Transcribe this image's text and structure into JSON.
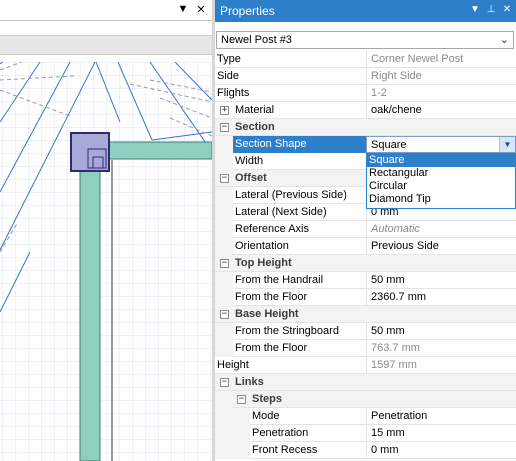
{
  "left_panel": {
    "chevron_icon": "chevron-down-icon",
    "close_icon": "close-icon"
  },
  "properties": {
    "title": "Properties",
    "object": "Newel Post #3",
    "rows": {
      "type": {
        "label": "Type",
        "value": "Corner Newel Post"
      },
      "side": {
        "label": "Side",
        "value": "Right Side"
      },
      "flights": {
        "label": "Flights",
        "value": "1-2"
      },
      "material": {
        "label": "Material",
        "value": "oak/chene"
      },
      "section": {
        "label": "Section"
      },
      "section_shape": {
        "label": "Section Shape",
        "value": "Square"
      },
      "width": {
        "label": "Width"
      },
      "offset": {
        "label": "Offset"
      },
      "lateral_prev": {
        "label": "Lateral (Previous Side)"
      },
      "lateral_next": {
        "label": "Lateral (Next Side)",
        "value": "0 mm"
      },
      "reference_axis": {
        "label": "Reference Axis",
        "value": "Automatic"
      },
      "orientation": {
        "label": "Orientation",
        "value": "Previous Side"
      },
      "top_height": {
        "label": "Top Height"
      },
      "top_from_handrail": {
        "label": "From the Handrail",
        "value": "50 mm"
      },
      "top_from_floor": {
        "label": "From the Floor",
        "value": "2360.7 mm"
      },
      "base_height": {
        "label": "Base Height"
      },
      "base_from_stringboard": {
        "label": "From the Stringboard",
        "value": "50 mm"
      },
      "base_from_floor": {
        "label": "From the Floor",
        "value": "763.7 mm"
      },
      "height": {
        "label": "Height",
        "value": "1597 mm"
      },
      "links": {
        "label": "Links"
      },
      "steps": {
        "label": "Steps"
      },
      "mode": {
        "label": "Mode",
        "value": "Penetration"
      },
      "penetration": {
        "label": "Penetration",
        "value": "15 mm"
      },
      "front_recess": {
        "label": "Front Recess",
        "value": "0 mm"
      }
    },
    "section_shape_options": [
      "Square",
      "Rectangular",
      "Circular",
      "Diamond Tip"
    ],
    "expander_plus": "+",
    "expander_minus": "−",
    "title_buttons": [
      "▼",
      "⊥",
      "✕"
    ],
    "object_chevron": "⌄",
    "combo_arrow": "▼"
  },
  "colors": {
    "accent": "#2e7fc9",
    "post_fill": "#8fcfc0",
    "newel_fill": "#a9a9d9"
  }
}
